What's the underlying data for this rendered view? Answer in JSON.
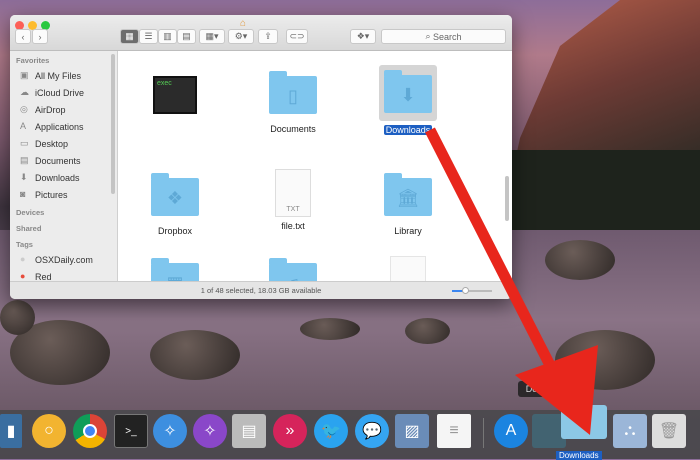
{
  "finder": {
    "toolbar": {
      "search_placeholder": "Search"
    },
    "sidebar": {
      "favorites_header": "Favorites",
      "favorites": [
        {
          "label": "All My Files",
          "icon": "all-files-icon"
        },
        {
          "label": "iCloud Drive",
          "icon": "cloud-icon"
        },
        {
          "label": "AirDrop",
          "icon": "airdrop-icon"
        },
        {
          "label": "Applications",
          "icon": "applications-icon"
        },
        {
          "label": "Desktop",
          "icon": "desktop-icon"
        },
        {
          "label": "Documents",
          "icon": "documents-icon"
        },
        {
          "label": "Downloads",
          "icon": "downloads-icon"
        },
        {
          "label": "Pictures",
          "icon": "pictures-icon"
        }
      ],
      "devices_header": "Devices",
      "shared_header": "Shared",
      "tags_header": "Tags",
      "tags": [
        {
          "label": "OSXDaily.com",
          "color": "#cccccc"
        },
        {
          "label": "Red",
          "color": "#e74c3c"
        }
      ]
    },
    "files": [
      {
        "name": "",
        "thumb_text": "exec"
      },
      {
        "name": "Documents"
      },
      {
        "name": "Downloads",
        "selected": true
      },
      {
        "name": "Dropbox"
      },
      {
        "name": "file.txt",
        "thumb_text": "TXT"
      },
      {
        "name": "Library"
      }
    ],
    "status": "1 of 48 selected, 18.03 GB available"
  },
  "dock": {
    "tooltip": "Downloads",
    "downloads_label": "Downloads"
  },
  "colors": {
    "arrow": "#e8261c",
    "folder": "#7fc6ee",
    "selection": "#1d5fc2"
  }
}
